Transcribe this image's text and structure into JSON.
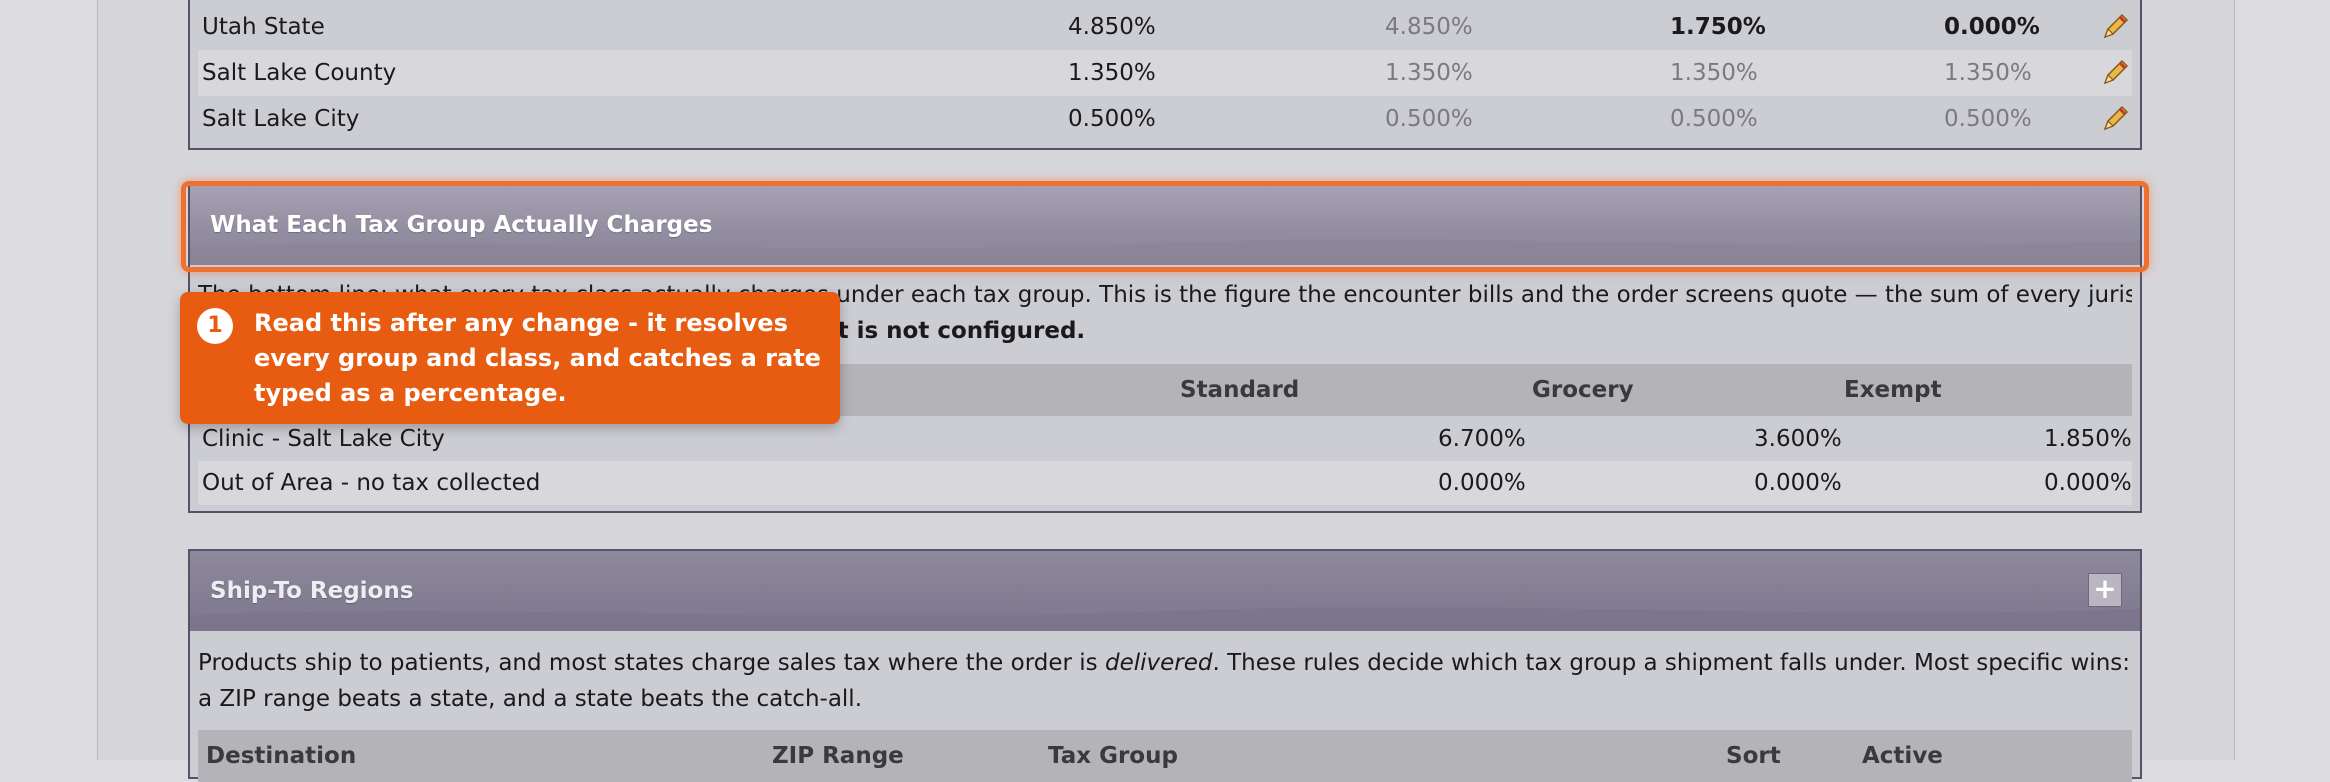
{
  "jurisdictions": {
    "rows": [
      {
        "name": "Utah State",
        "c1": "4.850%",
        "c2": "4.850%",
        "c3": "1.750%",
        "c4": "0.000%"
      },
      {
        "name": "Salt Lake County",
        "c1": "1.350%",
        "c2": "1.350%",
        "c3": "1.350%",
        "c4": "1.350%"
      },
      {
        "name": "Salt Lake City",
        "c1": "0.500%",
        "c2": "0.500%",
        "c3": "0.500%",
        "c4": "0.500%"
      }
    ]
  },
  "group_charges": {
    "title": "What Each Tax Group Actually Charges",
    "description_line1": "The bottom line: what every tax class actually charges under each tax group. This is the figure the encounter bills and the order screens quote — the sum of every jurisdiction in the group,",
    "description_line2_bold": "re, it is not configured.",
    "columns": [
      "Standard",
      "Grocery",
      "Exempt"
    ],
    "rows": [
      {
        "name": "Clinic - Salt Lake City",
        "standard": "6.700%",
        "grocery": "3.600%",
        "exempt": "1.850%"
      },
      {
        "name": "Out of Area - no tax collected",
        "standard": "0.000%",
        "grocery": "0.000%",
        "exempt": "0.000%"
      }
    ]
  },
  "callout": {
    "number": "1",
    "text": "Read this after any change - it resolves every group and class, and catches a rate typed as a percentage."
  },
  "ship_to": {
    "title": "Ship-To Regions",
    "expand_label": "+",
    "description_start": "Products ship to patients, and most states charge sales tax where the order is ",
    "description_em": "delivered",
    "description_end": ". These rules decide which tax group a shipment falls under. Most specific wins: a ZIP range beats a state, and a state beats the catch-all.",
    "columns": [
      "Destination",
      "ZIP Range",
      "Tax Group",
      "Sort",
      "Active"
    ]
  },
  "colors": {
    "accent": "#e85c12",
    "header": "#948ea2",
    "border": "#55526a"
  }
}
